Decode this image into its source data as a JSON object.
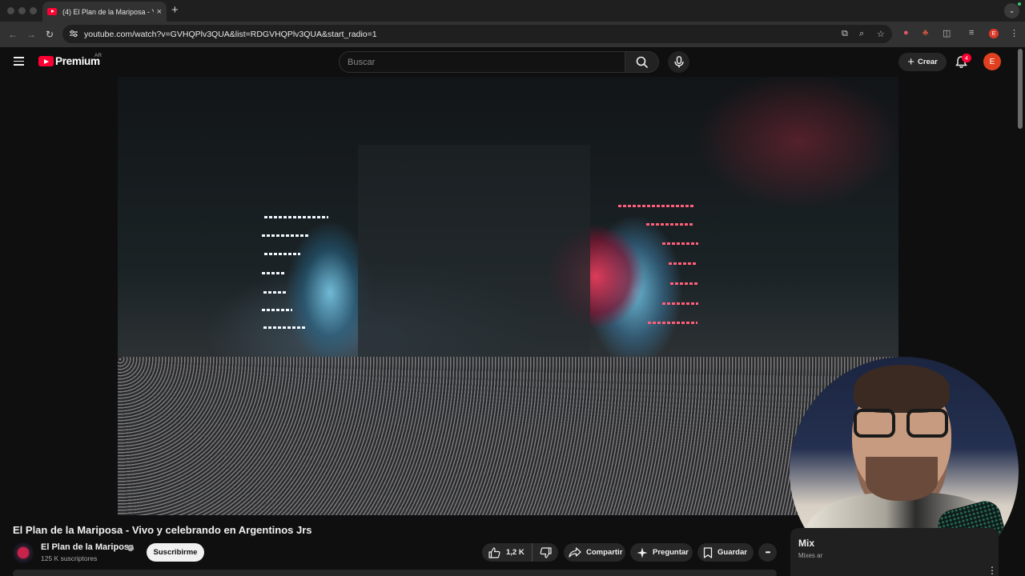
{
  "browser": {
    "tab_title": "(4) El Plan de la Mariposa - Y",
    "tab_close": "×",
    "new_tab": "+",
    "tab_menu": "⌄",
    "url": "youtube.com/watch?v=GVHQPlv3QUA&list=RDGVHQPlv3QUA&start_radio=1",
    "ext_avatar_letter": "E"
  },
  "masthead": {
    "brand": "Premium",
    "country_code": "AR",
    "search_placeholder": "Buscar",
    "create_label": "Crear",
    "create_plus": "+",
    "notifications_count": "4",
    "avatar_letter": "E"
  },
  "video": {
    "title": "El Plan de la Mariposa - Vivo y celebrando en Argentinos Jrs",
    "channel_name": "El Plan de la Mariposa",
    "verified_mark": "✓",
    "subscribers": "125 K suscriptores",
    "subscribe_label": "Suscribirme"
  },
  "actions": {
    "like_count": "1,2 K",
    "share_label": "Compartir",
    "ask_label": "Preguntar",
    "save_label": "Guardar",
    "more": "•••"
  },
  "mix": {
    "title": "Mix",
    "subtitle": "Mixes ar",
    "more": "⋮"
  },
  "colors": {
    "brand_red": "#ff0033",
    "background": "#0f0f0f",
    "pill_bg": "#272727",
    "subscribe_bg": "#f1f1f1"
  },
  "icons": [
    "hamburger-icon",
    "youtube-logo-icon",
    "search-icon",
    "mic-icon",
    "plus-icon",
    "bell-icon",
    "like-icon",
    "dislike-icon",
    "share-icon",
    "sparkle-icon",
    "bookmark-icon",
    "more-icon",
    "verified-icon"
  ]
}
